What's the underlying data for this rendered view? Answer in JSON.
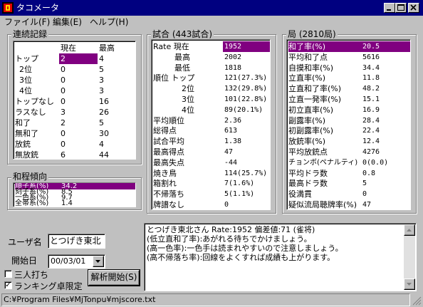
{
  "window": {
    "title": "タコメータ",
    "accent": "#000080",
    "selection": "#800080"
  },
  "menu": [
    "ファイル(F)",
    "編集(E)",
    "ヘルプ(H)"
  ],
  "streak": {
    "title": "連続記録",
    "col_headers": [
      "現在",
      "最高"
    ],
    "rows": [
      {
        "label": "トップ",
        "current": "2",
        "best": "4"
      },
      {
        "label": "2位",
        "current": "0",
        "best": "5"
      },
      {
        "label": "3位",
        "current": "0",
        "best": "3"
      },
      {
        "label": "4位",
        "current": "0",
        "best": "3"
      },
      {
        "label": "トップなし",
        "current": "0",
        "best": "16"
      },
      {
        "label": "ラスなし",
        "current": "3",
        "best": "26"
      },
      {
        "label": "和了",
        "current": "2",
        "best": "5"
      },
      {
        "label": "無和了",
        "current": "0",
        "best": "30"
      },
      {
        "label": "放銃",
        "current": "0",
        "best": "4"
      },
      {
        "label": "無放銃",
        "current": "6",
        "best": "44"
      }
    ]
  },
  "tendency": {
    "title": "和程傾向",
    "rows": [
      {
        "label": "順子系(%)",
        "value": "34.2"
      },
      {
        "label": "刻子系(%)",
        "value": "8.5"
      },
      {
        "label": "一色系(%)",
        "value": "9.7"
      },
      {
        "label": "全帯系(%)",
        "value": "1.4"
      }
    ]
  },
  "match": {
    "title": "試合 (443試合)",
    "rows": [
      {
        "label": "Rate 現在",
        "value": "1952"
      },
      {
        "label": "最高",
        "value": "2002"
      },
      {
        "label": "最低",
        "value": "1818"
      },
      {
        "label": "順位 トップ",
        "value": "121(27.3%)"
      },
      {
        "label": "2位",
        "value": "132(29.8%)"
      },
      {
        "label": "3位",
        "value": "101(22.8%)"
      },
      {
        "label": "4位",
        "value": "89(20.1%)"
      },
      {
        "label": "平均順位",
        "value": "2.36"
      },
      {
        "label": "総得点",
        "value": "613"
      },
      {
        "label": "試合平均",
        "value": "1.38"
      },
      {
        "label": "最高得点",
        "value": "47"
      },
      {
        "label": "最高失点",
        "value": "-44"
      },
      {
        "label": "焼き鳥",
        "value": "114(25.7%)"
      },
      {
        "label": "箱割れ",
        "value": "7(1.6%)"
      },
      {
        "label": "不帰落ち",
        "value": "5(1.1%)"
      },
      {
        "label": "牌譜なし",
        "value": "0"
      }
    ]
  },
  "hand": {
    "title": "局 (2810局)",
    "rows": [
      {
        "label": "和了率(%)",
        "value": "20.5"
      },
      {
        "label": "平均和了点",
        "value": "5616"
      },
      {
        "label": "自摸和率(%)",
        "value": "34.4"
      },
      {
        "label": "立直率(%)",
        "value": "11.8"
      },
      {
        "label": "立直和了率(%)",
        "value": "48.2"
      },
      {
        "label": "立直一発率(%)",
        "value": "15.1"
      },
      {
        "label": "初立直率(%)",
        "value": "16.9"
      },
      {
        "label": "副露率(%)",
        "value": "28.4"
      },
      {
        "label": "初副露率(%)",
        "value": "22.4"
      },
      {
        "label": "放銃率(%)",
        "value": "12.4"
      },
      {
        "label": "平均放銃点",
        "value": "4276"
      },
      {
        "label": "チョンボ(ペナルティ)",
        "value": "0(0.0)"
      },
      {
        "label": "平均ドラ数",
        "value": "0.8"
      },
      {
        "label": "最高ドラ数",
        "value": "5"
      },
      {
        "label": "役満貫",
        "value": "0"
      },
      {
        "label": "疑似流局聴牌率(%)",
        "value": "47"
      }
    ]
  },
  "controls": {
    "user_label": "ユーザ名",
    "user_value": "とつげき東北",
    "date_label": "開始日",
    "date_value": "00/03/01",
    "sanma_label": "三人打ち",
    "ranking_label": "ランキング卓限定",
    "ranking_checked": "✓",
    "analyze_label": "解析開始(S)"
  },
  "comment": {
    "lines": [
      "とつげき東北さん Rate:1952 偏差値:71 (雀将)",
      "(低立直和了率):あがれる待ちでかけましょう。",
      "(高一色率):一色手は読まれやすいので注意しましょう。",
      "(高不帰落ち率):回線をよくすれば成績も上がります。"
    ]
  },
  "status": {
    "path": "C:¥Program Files¥MjTonpu¥mjscore.txt"
  }
}
